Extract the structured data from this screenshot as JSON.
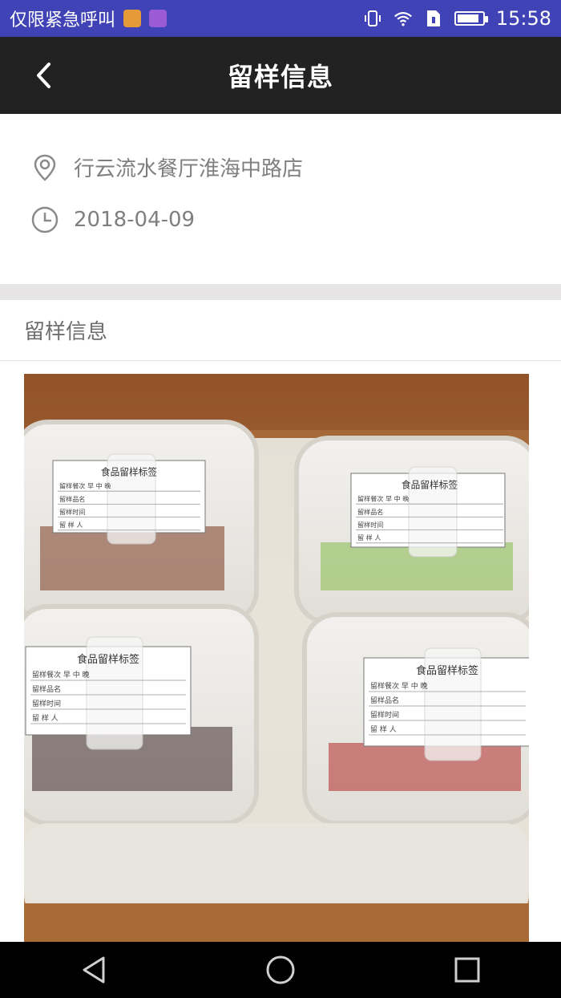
{
  "status_bar": {
    "carrier_text": "仅限紧急呼叫",
    "time": "15:58",
    "icons": [
      "notification-orange-icon",
      "notification-purple-icon",
      "vibrate-icon",
      "wifi-icon",
      "sim-icon",
      "battery-icon"
    ]
  },
  "header": {
    "title": "留样信息",
    "back_icon": "chevron-left-icon"
  },
  "info": {
    "location": "行云流水餐厅淮海中路店",
    "date": "2018-04-09"
  },
  "section": {
    "title": "留样信息"
  },
  "photo": {
    "boxes": [
      {
        "label_title": "食品留样标签",
        "rows": [
          "留样餐次",
          "留样品名",
          "留样时间",
          "留 样 人"
        ]
      },
      {
        "label_title": "食品留样标签",
        "rows": [
          "留样餐次",
          "留样品名",
          "留样时间",
          "留 样 人"
        ]
      },
      {
        "label_title": "食品留样标签",
        "rows": [
          "留样餐次",
          "留样品名",
          "留样时间",
          "留 样 人"
        ]
      },
      {
        "label_title": "食品留样标签",
        "rows": [
          "留样餐次",
          "留样品名",
          "留样时间",
          "留 样 人"
        ]
      }
    ],
    "meal_marks": "早  中  晚"
  },
  "nav": {
    "icons": [
      "back-triangle-icon",
      "home-circle-icon",
      "recents-square-icon"
    ]
  },
  "colors": {
    "status_bar": "#3f43b5",
    "app_bar": "#222222",
    "secondary_text": "#7f7f7f",
    "divider_band": "#e6e4e4"
  }
}
